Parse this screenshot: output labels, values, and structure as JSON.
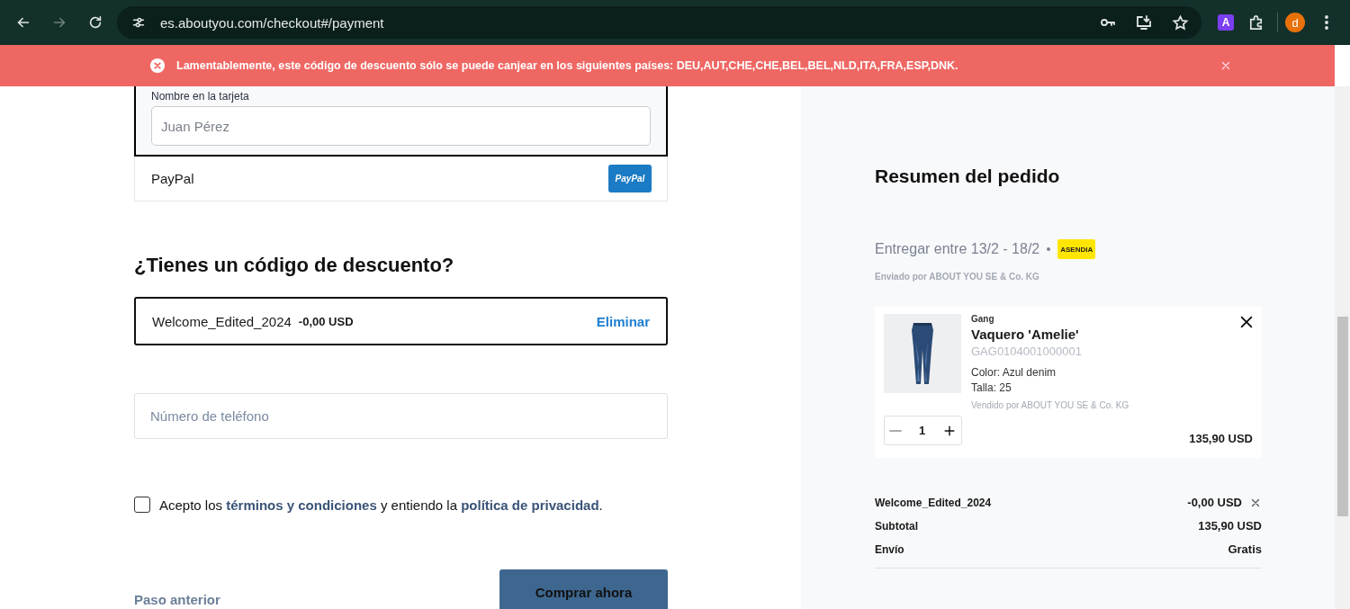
{
  "browser": {
    "url": "es.aboutyou.com/checkout#/payment",
    "extension_badge": "A",
    "profile_initial": "d"
  },
  "alert": {
    "message": "Lamentablemente, este código de descuento sólo se puede canjear en los siguientes países: DEU,AUT,CHE,CHE,BEL,BEL,NLD,ITA,FRA,ESP,DNK."
  },
  "payment": {
    "card_name_label": "Nombre en la tarjeta",
    "card_name_placeholder": "Juan Pérez",
    "paypal_label": "PayPal",
    "paypal_logo": "PayPal"
  },
  "discount": {
    "heading": "¿Tienes un código de descuento?",
    "code": "Welcome_Edited_2024",
    "amount": "-0,00 USD",
    "remove": "Eliminar"
  },
  "phone": {
    "placeholder": "Número de teléfono"
  },
  "terms": {
    "checked": false,
    "parts": [
      {
        "kind": "text",
        "text": "Acepto los "
      },
      {
        "kind": "link",
        "text": "términos y condiciones"
      },
      {
        "kind": "text",
        "text": " y entiendo la "
      },
      {
        "kind": "link",
        "text": "política de privacidad"
      },
      {
        "kind": "text",
        "text": "."
      }
    ]
  },
  "actions": {
    "back": "Paso anterior",
    "buy": "Comprar ahora"
  },
  "summary": {
    "title": "Resumen del pedido",
    "delivery": "Entregar entre 13/2 - 18/2",
    "carrier_logo": "ASENDIA",
    "shipped_by": "Enviado por ABOUT YOU SE & Co. KG",
    "item": {
      "brand": "Gang",
      "name": "Vaquero 'Amelie'",
      "sku": "GAG0104001000001",
      "color_text": "Color: Azul denim",
      "size": "Talla: 25",
      "sold_by": "Vendido por ABOUT YOU SE & Co. KG",
      "quantity": "1",
      "price": "135,90 USD"
    },
    "rows": [
      {
        "kind": "discount",
        "label": "Welcome_Edited_2024",
        "value": "-0,00 USD"
      },
      {
        "kind": "plain",
        "label": "Subtotal",
        "value": "135,90 USD"
      },
      {
        "kind": "plain",
        "label": "Envío",
        "value": "Gratis"
      }
    ]
  }
}
